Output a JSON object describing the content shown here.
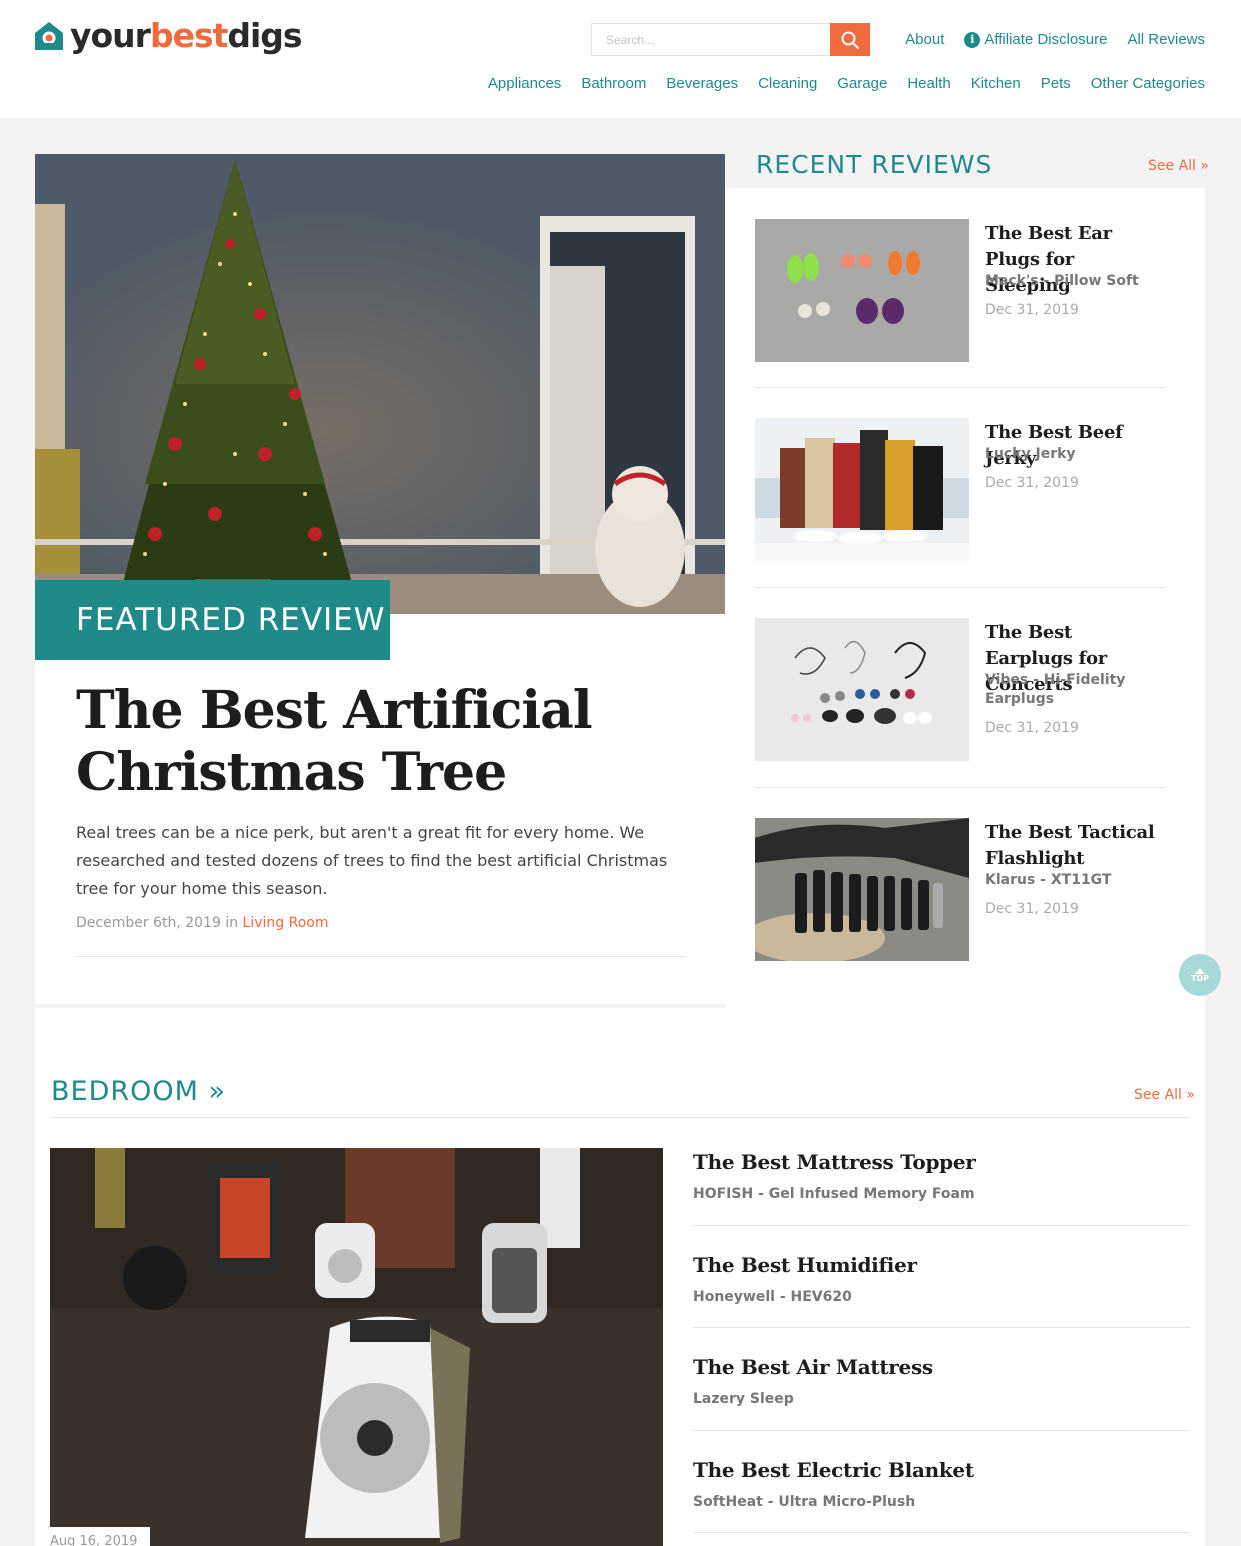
{
  "header": {
    "logo": {
      "part1": "your",
      "part2": "best",
      "part3": "digs"
    },
    "search_placeholder": "Search...",
    "top_links": [
      "About",
      "Affiliate Disclosure",
      "All Reviews"
    ],
    "categories": [
      "Appliances",
      "Bathroom",
      "Beverages",
      "Cleaning",
      "Garage",
      "Health",
      "Kitchen",
      "Pets",
      "Other Categories"
    ]
  },
  "featured": {
    "badge": "FEATURED REVIEW",
    "title": "The Best Artificial Christmas Tree",
    "description": "Real trees can be a nice perk, but aren't a great fit for every home. We researched and tested dozens of trees to find the best artificial Christmas tree for your home this season.",
    "date": "December 6th, 2019",
    "in_word": "in",
    "category": "Living Room"
  },
  "recent_reviews": {
    "heading": "RECENT REVIEWS",
    "see_all": "See All »",
    "items": [
      {
        "title": "The Best Ear Plugs for Sleeping",
        "product": "Mack's - Pillow Soft",
        "date": "Dec 31, 2019"
      },
      {
        "title": "The Best Beef Jerky",
        "product": "Lucky Jerky",
        "date": "Dec 31, 2019"
      },
      {
        "title": "The Best Earplugs for Concerts",
        "product": "Vibes - Hi-Fidelity Earplugs",
        "date": "Dec 31, 2019"
      },
      {
        "title": "The Best Tactical Flashlight",
        "product": "Klarus - XT11GT",
        "date": "Dec 31, 2019"
      }
    ]
  },
  "top_button": "TOP",
  "bedroom": {
    "heading": "BEDROOM »",
    "see_all": "See All »",
    "image_date": "Aug 16, 2019",
    "items": [
      {
        "title": "The Best Mattress Topper",
        "product": "HOFISH - Gel Infused Memory Foam"
      },
      {
        "title": "The Best Humidifier",
        "product": "Honeywell - HEV620"
      },
      {
        "title": "The Best Air Mattress",
        "product": "Lazery Sleep"
      },
      {
        "title": "The Best Electric Blanket",
        "product": "SoftHeat - Ultra Micro-Plush"
      }
    ]
  },
  "colors": {
    "teal": "#1f8a8a",
    "orange": "#ef6a3d"
  }
}
